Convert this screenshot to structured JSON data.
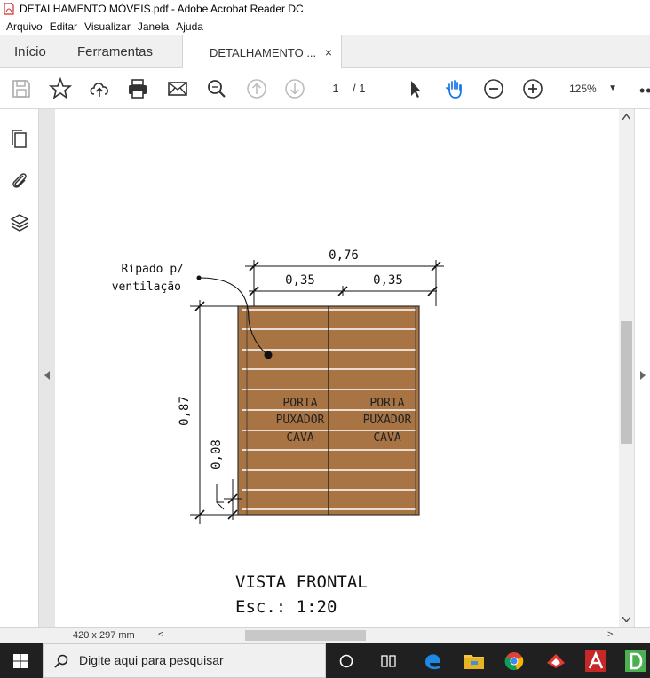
{
  "window": {
    "title": "DETALHAMENTO MÓVEIS.pdf - Adobe Acrobat Reader DC"
  },
  "menu": {
    "items": [
      "Arquivo",
      "Editar",
      "Visualizar",
      "Janela",
      "Ajuda"
    ]
  },
  "tabs": {
    "home": "Início",
    "tools": "Ferramentas",
    "document": "DETALHAMENTO ...",
    "close": "×"
  },
  "toolbar": {
    "page_current": "1",
    "page_total": "/ 1",
    "zoom": "125%",
    "zoom_caret": "▼",
    "more": "••"
  },
  "drawing": {
    "dim_total_width": "0,76",
    "dim_left": "0,35",
    "dim_right": "0,35",
    "dim_height": "0,87",
    "dim_base": "0,08",
    "callout_line1": "Ripado p/",
    "callout_line2": "ventilação",
    "door_left": [
      "PORTA",
      "PUXADOR",
      "CAVA"
    ],
    "door_right": [
      "PORTA",
      "PUXADOR",
      "CAVA"
    ],
    "view_title": "VISTA FRONTAL",
    "scale": "Esc.: 1:20",
    "wood_color": "#a87443"
  },
  "status": {
    "page_size": "420 x 297 mm",
    "scroll_left": "<",
    "scroll_right": ">"
  },
  "taskbar": {
    "search_placeholder": "Digite aqui para pesquisar"
  }
}
